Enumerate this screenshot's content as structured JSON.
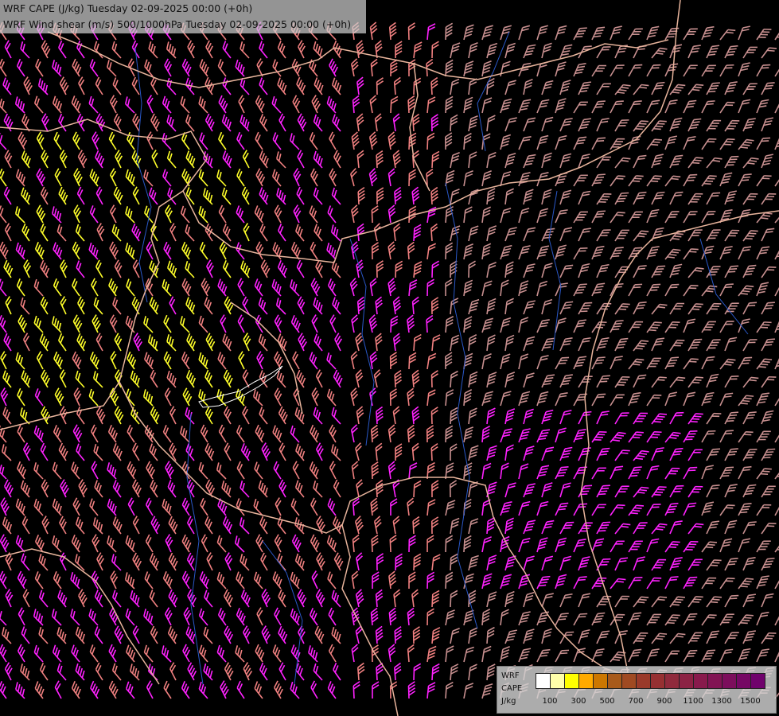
{
  "header": {
    "line1": "WRF CAPE (J/kg) Tuesday 02-09-2025 00:00 (+0h)",
    "line2": "WRF Wind shear (m/s) 500/1000hPa Tuesday 02-09-2025 00:00 (+0h)"
  },
  "legend": {
    "model": "WRF",
    "field": "CAPE",
    "unit": "J/kg",
    "ticks": [
      "100",
      "300",
      "500",
      "700",
      "900",
      "1100",
      "1300",
      "1500"
    ],
    "colors": [
      "#ffffff",
      "#ffffaa",
      "#ffff00",
      "#ffaa00",
      "#cc7700",
      "#a85a1a",
      "#a04a22",
      "#9a3a2a",
      "#963032",
      "#902a3c",
      "#8c2244",
      "#881a4c",
      "#821454",
      "#7c0e5c",
      "#760864",
      "#70026c"
    ]
  },
  "map_colors": {
    "background": "#000000",
    "border": "#e8b49c",
    "river": "#2a58c8",
    "barb_yellow": "#ffff2a",
    "barb_magenta": "#ff22ff",
    "barb_salmon": "#f08080",
    "barb_rose": "#c89090"
  }
}
